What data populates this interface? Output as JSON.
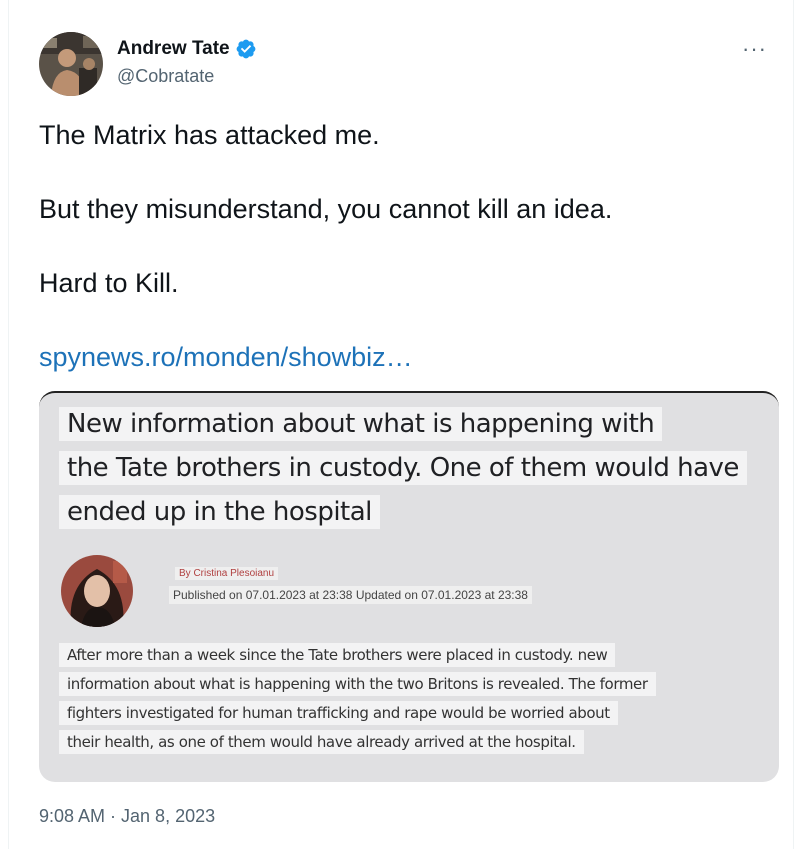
{
  "tweet": {
    "author_name": "Andrew Tate",
    "handle": "@Cobratate",
    "more_label": "···",
    "lines": [
      "The Matrix has attacked me.",
      "But they misunderstand, you cannot kill an idea.",
      "Hard to Kill."
    ],
    "link": "spynews.ro/monden/showbiz…",
    "timestamp": "9:08 AM · Jan 8, 2023"
  },
  "embed": {
    "headline_lines": [
      "New information about what is happening with",
      "the Tate brothers in custody. One of them would have",
      "ended up in the hospital"
    ],
    "byline": "By Cristina Plesoianu",
    "published": "Published on 07.01.2023 at 23:38 Updated on 07.01.2023 at 23:38",
    "paragraph_lines": [
      "After more than a week since the Tate brothers were placed in custody. new",
      "information about what is happening with the two Britons is revealed. The former",
      "fighters investigated for human trafficking and rape would be worried about",
      "their health, as one of them would have already arrived at the hospital."
    ]
  },
  "colors": {
    "verified_blue": "#1d9bf0",
    "link_blue": "#1d72b8",
    "secondary_text": "#536471"
  },
  "icons": {
    "verified": "verified-badge-icon",
    "more": "more-options-icon"
  }
}
